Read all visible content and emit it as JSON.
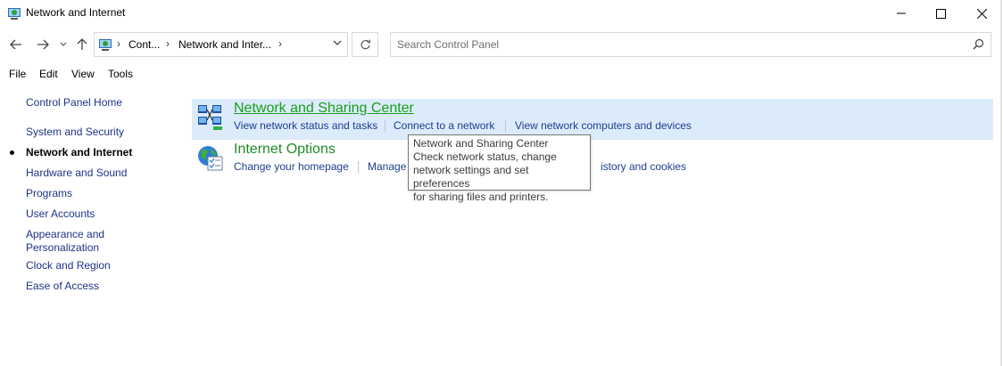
{
  "window": {
    "title": "Network and Internet"
  },
  "address": {
    "segments": [
      "Cont...",
      "Network and Inter..."
    ]
  },
  "search": {
    "placeholder": "Search Control Panel"
  },
  "menu": [
    "File",
    "Edit",
    "View",
    "Tools"
  ],
  "sidebar": {
    "home": "Control Panel Home",
    "items": [
      {
        "label": "System and Security",
        "active": false
      },
      {
        "label": "Network and Internet",
        "active": true
      },
      {
        "label": "Hardware and Sound",
        "active": false
      },
      {
        "label": "Programs",
        "active": false
      },
      {
        "label": "User Accounts",
        "active": false
      },
      {
        "label": "Appearance and\nPersonalization",
        "active": false
      },
      {
        "label": "Clock and Region",
        "active": false
      },
      {
        "label": "Ease of Access",
        "active": false
      }
    ]
  },
  "categories": [
    {
      "title": "Network and Sharing Center",
      "icon": "network-sharing-icon",
      "links": [
        "View network status and tasks",
        "Connect to a network",
        "View network computers and devices"
      ]
    },
    {
      "title": "Internet Options",
      "icon": "internet-options-icon",
      "links": [
        "Change your homepage",
        "Manage",
        "istory and cookies"
      ]
    }
  ],
  "tooltip": {
    "lines": [
      "Network and Sharing Center",
      "Check network status, change",
      "network settings and set preferences",
      "for sharing files and printers."
    ]
  },
  "colors": {
    "link": "#1e3d8f",
    "category_title": "#1e8b2a",
    "hover_bg": "#dcebfc"
  }
}
